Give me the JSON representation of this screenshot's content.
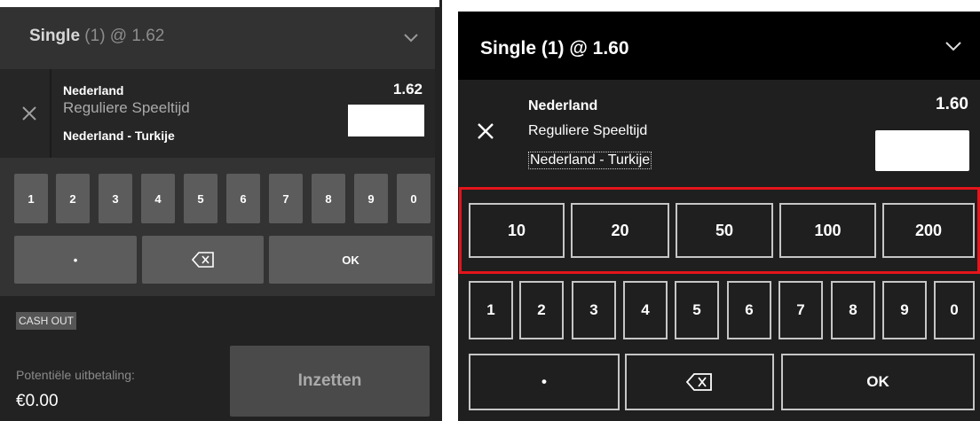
{
  "left": {
    "header": {
      "title_bold": "Single",
      "title_rest": "(1) @ 1.62"
    },
    "selection": {
      "name": "Nederland",
      "market": "Reguliere Speeltijd",
      "event": "Nederland - Turkije",
      "odds": "1.62",
      "stake_value": ""
    },
    "keypad": {
      "digits": [
        "1",
        "2",
        "3",
        "4",
        "5",
        "6",
        "7",
        "8",
        "9",
        "0"
      ],
      "decimal": "•",
      "backspace": "⌫",
      "ok": "OK"
    },
    "cashout": "CASH OUT",
    "payout": {
      "label": "Potentiële uitbetaling:",
      "value": "€0.00"
    },
    "place_button": "Inzetten"
  },
  "right": {
    "header": {
      "title": "Single (1) @ 1.60"
    },
    "selection": {
      "name": "Nederland",
      "market": "Reguliere Speeltijd",
      "event": "Nederland - Turkije",
      "odds": "1.60",
      "stake_value": ""
    },
    "quick_stakes": [
      "10",
      "20",
      "50",
      "100",
      "200"
    ],
    "keypad": {
      "digits": [
        "1",
        "2",
        "3",
        "4",
        "5",
        "6",
        "7",
        "8",
        "9",
        "0"
      ],
      "decimal": "•",
      "backspace": "⌫",
      "ok": "OK"
    }
  },
  "colors": {
    "left_bg": "#222222",
    "left_header": "#323232",
    "left_key": "#5c5c5c",
    "right_bg": "#1f1f1f",
    "right_header": "#000000",
    "key_border": "#c6c6c6",
    "highlight": "#e5141b"
  },
  "icons": [
    "chevron-down-icon",
    "close-icon",
    "backspace-icon"
  ]
}
